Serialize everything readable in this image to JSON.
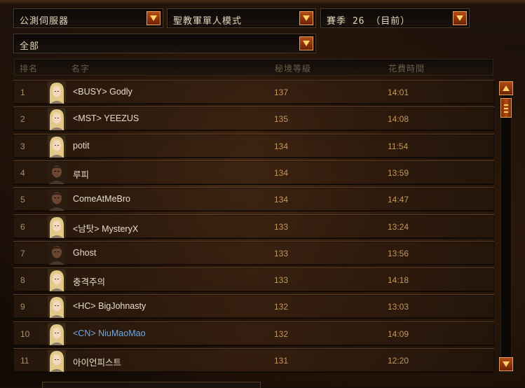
{
  "filters": {
    "server": "公測伺服器",
    "mode": "聖教軍單人模式",
    "season": "賽季 26 （目前）",
    "class_filter": "全部"
  },
  "columns": {
    "rank": "排名",
    "name": "名字",
    "rift_level": "秘境等級",
    "time": "花費時間"
  },
  "rows": [
    {
      "rank": "1",
      "name": "<BUSY> Godly",
      "level": "137",
      "time": "14:01",
      "portrait": "female-crusader-portrait-icon"
    },
    {
      "rank": "2",
      "name": "<MST> YEEZUS",
      "level": "135",
      "time": "14:08",
      "portrait": "female-crusader-portrait-icon"
    },
    {
      "rank": "3",
      "name": "potit",
      "level": "134",
      "time": "11:54",
      "portrait": "female-crusader-portrait-icon"
    },
    {
      "rank": "4",
      "name": "루피",
      "level": "134",
      "time": "13:59",
      "portrait": "male-crusader-portrait-icon"
    },
    {
      "rank": "5",
      "name": "ComeAtMeBro",
      "level": "134",
      "time": "14:47",
      "portrait": "male-crusader-portrait-icon"
    },
    {
      "rank": "6",
      "name": "<남탓> MysteryX",
      "level": "133",
      "time": "13:24",
      "portrait": "female-crusader-portrait-icon"
    },
    {
      "rank": "7",
      "name": "Ghost",
      "level": "133",
      "time": "13:56",
      "portrait": "male-crusader-portrait-icon"
    },
    {
      "rank": "8",
      "name": "충격주의",
      "level": "133",
      "time": "14:18",
      "portrait": "female-crusader-portrait-icon"
    },
    {
      "rank": "9",
      "name": "<HC> BigJohnasty",
      "level": "132",
      "time": "13:03",
      "portrait": "female-crusader-portrait-icon"
    },
    {
      "rank": "10",
      "name": "<CN> NiuMaoMao",
      "level": "132",
      "time": "14:09",
      "portrait": "female-crusader-portrait-icon",
      "highlight_color": "#6fa7e4"
    },
    {
      "rank": "11",
      "name": "아이언피스트",
      "level": "131",
      "time": "12:20",
      "portrait": "female-crusader-portrait-icon"
    }
  ],
  "colors": {
    "accent": "#b44a12",
    "value_text": "#c4985a",
    "name_text": "#e7dccb",
    "highlight_name": "#6fa7e4"
  }
}
